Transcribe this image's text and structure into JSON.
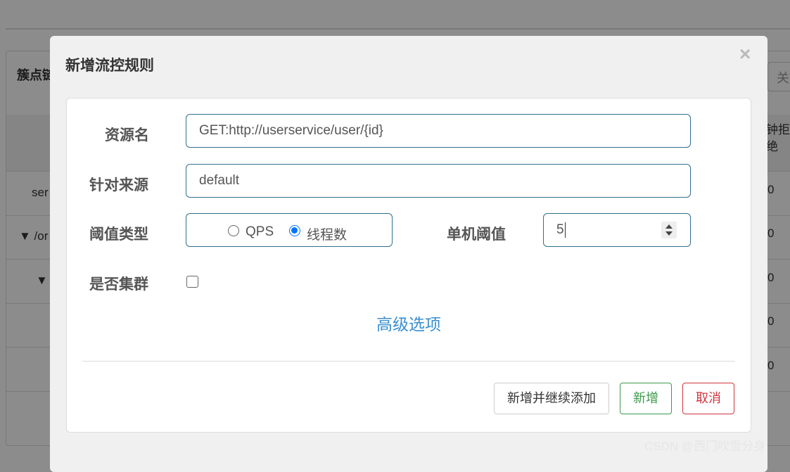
{
  "background": {
    "header_label": "簇点链路",
    "search_placeholder": "关键字",
    "head_right": "钟拒绝",
    "rows": [
      {
        "left": "ser",
        "right": "0"
      },
      {
        "left": "▼ /or",
        "right": "0"
      },
      {
        "left": "▼",
        "right": "0"
      },
      {
        "left": "",
        "right": "0"
      },
      {
        "left": "",
        "right": "0"
      }
    ]
  },
  "modal": {
    "title": "新增流控规则",
    "close_symbol": "×",
    "form": {
      "resource_label": "资源名",
      "resource_value": "GET:http://userservice/user/{id}",
      "origin_label": "针对来源",
      "origin_value": "default",
      "threshold_type_label": "阈值类型",
      "threshold_type_options": [
        "QPS",
        "线程数"
      ],
      "threshold_type_selected": "线程数",
      "single_threshold_label": "单机阈值",
      "single_threshold_value": "5",
      "cluster_label": "是否集群",
      "cluster_checked": false
    },
    "advanced_link": "高级选项",
    "buttons": {
      "add_continue": "新增并继续添加",
      "add": "新增",
      "cancel": "取消"
    }
  },
  "watermark": "CSDN @西门吹雪分身",
  "colors": {
    "input_border": "#31708f",
    "link": "#3a8fd0",
    "success": "#3c9a4b",
    "danger": "#d0343e",
    "radio_checked": "#0075ff"
  }
}
